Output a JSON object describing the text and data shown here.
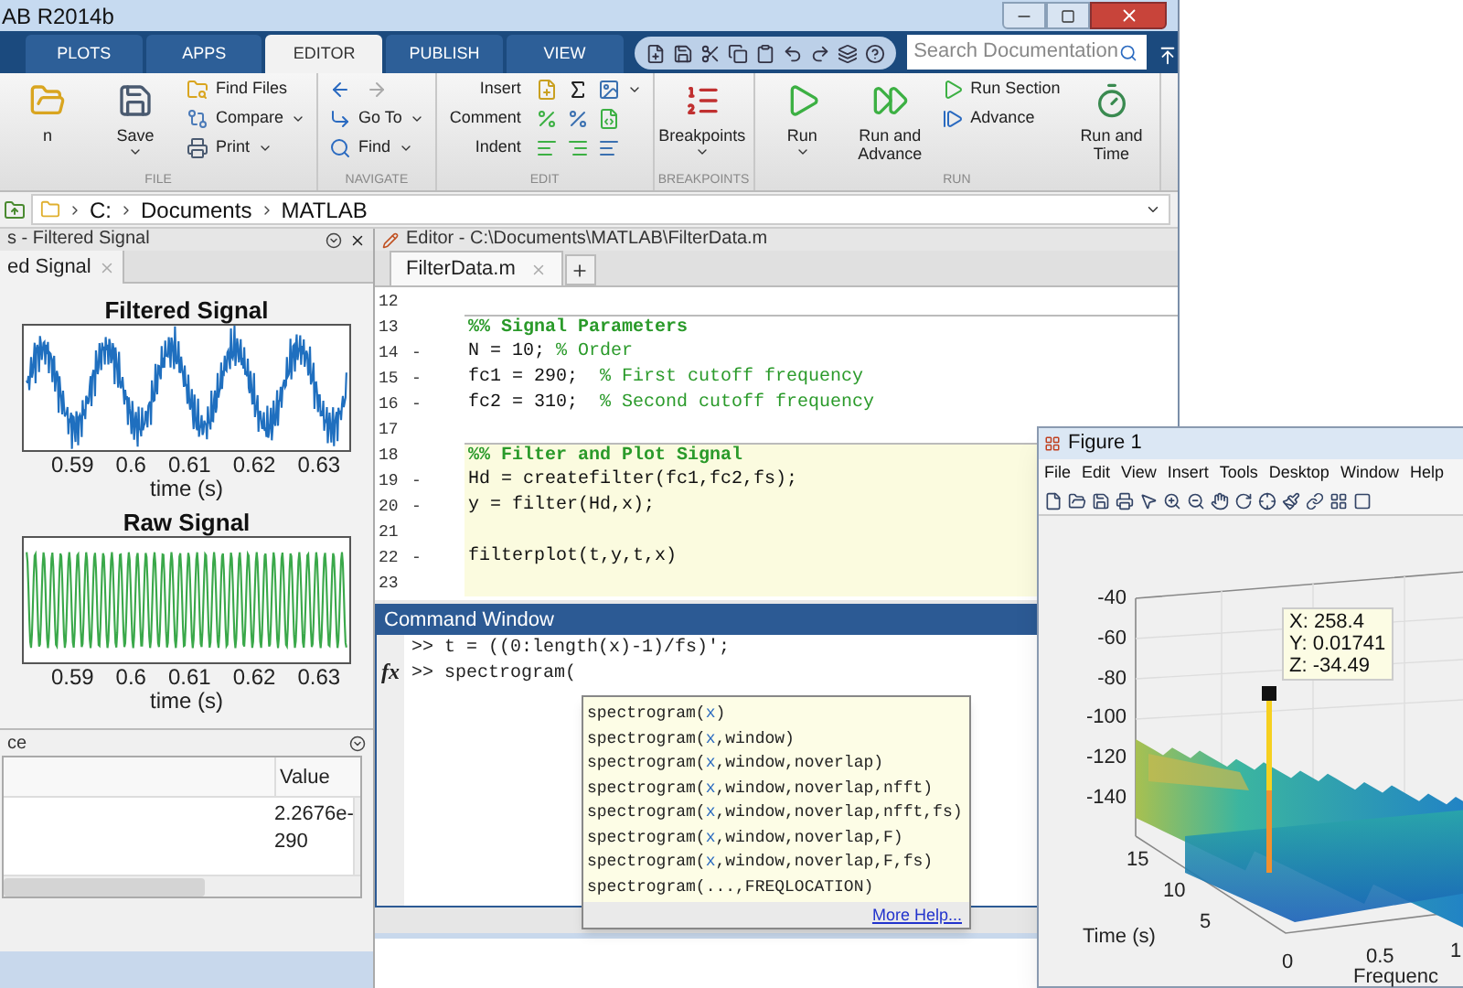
{
  "window": {
    "title": "AB R2014b"
  },
  "tabs": [
    {
      "label": "PLOTS",
      "selected": false
    },
    {
      "label": "APPS",
      "selected": false
    },
    {
      "label": "EDITOR",
      "selected": true
    },
    {
      "label": "PUBLISH",
      "selected": false
    },
    {
      "label": "VIEW",
      "selected": false
    }
  ],
  "search": {
    "placeholder": "Search Documentation"
  },
  "ribbon": {
    "sections": [
      {
        "label": "FILE",
        "columns": [
          [
            {
              "kind": "large",
              "label": "n"
            }
          ],
          [
            {
              "kind": "large",
              "label": "Save",
              "dropdown": true
            }
          ],
          [
            {
              "kind": "small",
              "label": "Find Files",
              "dropdown": false
            },
            {
              "kind": "small",
              "label": "Compare",
              "dropdown": true
            },
            {
              "kind": "small",
              "label": "Print",
              "dropdown": true
            }
          ]
        ]
      },
      {
        "label": "NAVIGATE",
        "columns": [
          [
            {
              "kind": "icons"
            },
            {
              "kind": "small",
              "label": "Go To",
              "dropdown": true
            },
            {
              "kind": "small",
              "label": "Find",
              "dropdown": true
            }
          ]
        ]
      },
      {
        "label": "EDIT",
        "columns": [
          [
            {
              "kind": "icon_row",
              "label": "Insert",
              "dropdown": true
            },
            {
              "kind": "icon_row",
              "label": "Comment",
              "dropdown": false
            },
            {
              "kind": "icon_row",
              "label": "Indent",
              "dropdown": false
            }
          ]
        ]
      },
      {
        "label": "BREAKPOINTS",
        "columns": [
          [
            {
              "kind": "large",
              "label": "Breakpoints",
              "dropdown": true
            }
          ]
        ]
      },
      {
        "label": "RUN",
        "columns": [
          [
            {
              "kind": "large",
              "label": "Run",
              "dropdown": true
            }
          ],
          [
            {
              "kind": "large",
              "label": "Run and Advance",
              "dropdown": false
            }
          ],
          [
            {
              "kind": "small",
              "label": "Run Section",
              "dropdown": false
            },
            {
              "kind": "small",
              "label": "Advance",
              "dropdown": false
            }
          ],
          [
            {
              "kind": "large",
              "label": "Run and Time",
              "dropdown": false
            }
          ]
        ]
      }
    ]
  },
  "address": {
    "segments": [
      "C:",
      "Documents",
      "MATLAB"
    ]
  },
  "figures_panel": {
    "title": "s - Filtered Signal",
    "tab": "ed Signal",
    "plots": [
      {
        "title": "Filtered Signal",
        "kind": "noisy",
        "ticks": [
          "0.59",
          "0.6",
          "0.61",
          "0.62",
          "0.63"
        ],
        "xlabel": "time (s)"
      },
      {
        "title": "Raw Signal",
        "kind": "sine",
        "ticks": [
          "0.59",
          "0.6",
          "0.61",
          "0.62",
          "0.63"
        ],
        "xlabel": "time (s)"
      }
    ]
  },
  "workspace": {
    "title": "ce",
    "column": "Value",
    "values": [
      "2.2676e-",
      "290"
    ]
  },
  "editor": {
    "title": "Editor - C:\\Documents\\MATLAB\\FilterData.m",
    "tabs": [
      {
        "label": "FilterData.m",
        "selected": true
      }
    ],
    "lines": [
      {
        "number": "12",
        "highlighted": false
      },
      {
        "number": "13",
        "section": true,
        "comment": "%% Signal Parameters",
        "highlighted": false
      },
      {
        "number": "14",
        "marker": "-",
        "code": "N = 10; ",
        "comment": "% Order",
        "highlighted": false
      },
      {
        "number": "15",
        "marker": "-",
        "code": "fc1 = 290;  ",
        "comment": "% First cutoff frequency",
        "highlighted": false
      },
      {
        "number": "16",
        "marker": "-",
        "code": "fc2 = 310;  ",
        "comment": "% Second cutoff frequency",
        "highlighted": false
      },
      {
        "number": "17",
        "highlighted": false
      },
      {
        "number": "18",
        "section": true,
        "comment": "%% Filter and Plot Signal",
        "highlighted": true
      },
      {
        "number": "19",
        "marker": "-",
        "code": "Hd = createfilter(fc1,fc2,fs);",
        "highlighted": true
      },
      {
        "number": "20",
        "marker": "-",
        "code": "y = filter(Hd,x);",
        "highlighted": true
      },
      {
        "number": "21",
        "highlighted": true
      },
      {
        "number": "22",
        "marker": "-",
        "code": "filterplot(t,y,t,x)",
        "highlighted": true
      },
      {
        "number": "23",
        "highlighted": true
      }
    ]
  },
  "command_window": {
    "title": "Command Window",
    "function_hint": "fx",
    "lines": [
      {
        "prompt": ">>",
        "text": "t = ((0:length(x)-1)/fs)';"
      },
      {
        "prompt": ">>",
        "text": "spectrogram("
      }
    ],
    "suggestions": [
      {
        "name": "spectrogram(",
        "arg": "x",
        "rest": ")"
      },
      {
        "name": "spectrogram(",
        "arg": "x",
        "rest": ",window)"
      },
      {
        "name": "spectrogram(",
        "arg": "x",
        "rest": ",window,noverlap)"
      },
      {
        "name": "spectrogram(",
        "arg": "x",
        "rest": ",window,noverlap,nfft)"
      },
      {
        "name": "spectrogram(",
        "arg": "x",
        "rest": ",window,noverlap,nfft,fs)"
      },
      {
        "name": "spectrogram(",
        "arg": "x",
        "rest": ",window,noverlap,F)"
      },
      {
        "name": "spectrogram(",
        "arg": "x",
        "rest": ",window,noverlap,F,fs)"
      },
      {
        "name": "spectrogram(",
        "rest": "...,FREQLOCATION)"
      }
    ],
    "more_help": "More Help..."
  },
  "figure": {
    "title": "Figure 1",
    "menu": [
      "File",
      "Edit",
      "View",
      "Insert",
      "Tools",
      "Desktop",
      "Window",
      "Help"
    ],
    "z_ticks": [
      "-40",
      "-60",
      "-80",
      "-100",
      "-120",
      "-140"
    ],
    "time_ticks": [
      "15",
      "10",
      "5"
    ],
    "time_label": "Time (s)",
    "freq_ticks": [
      "0",
      "0.5",
      "1"
    ],
    "freq_label": "Frequenc",
    "datatip": [
      "X: 258.4",
      "Y: 0.01741",
      "Z: -34.49"
    ]
  }
}
